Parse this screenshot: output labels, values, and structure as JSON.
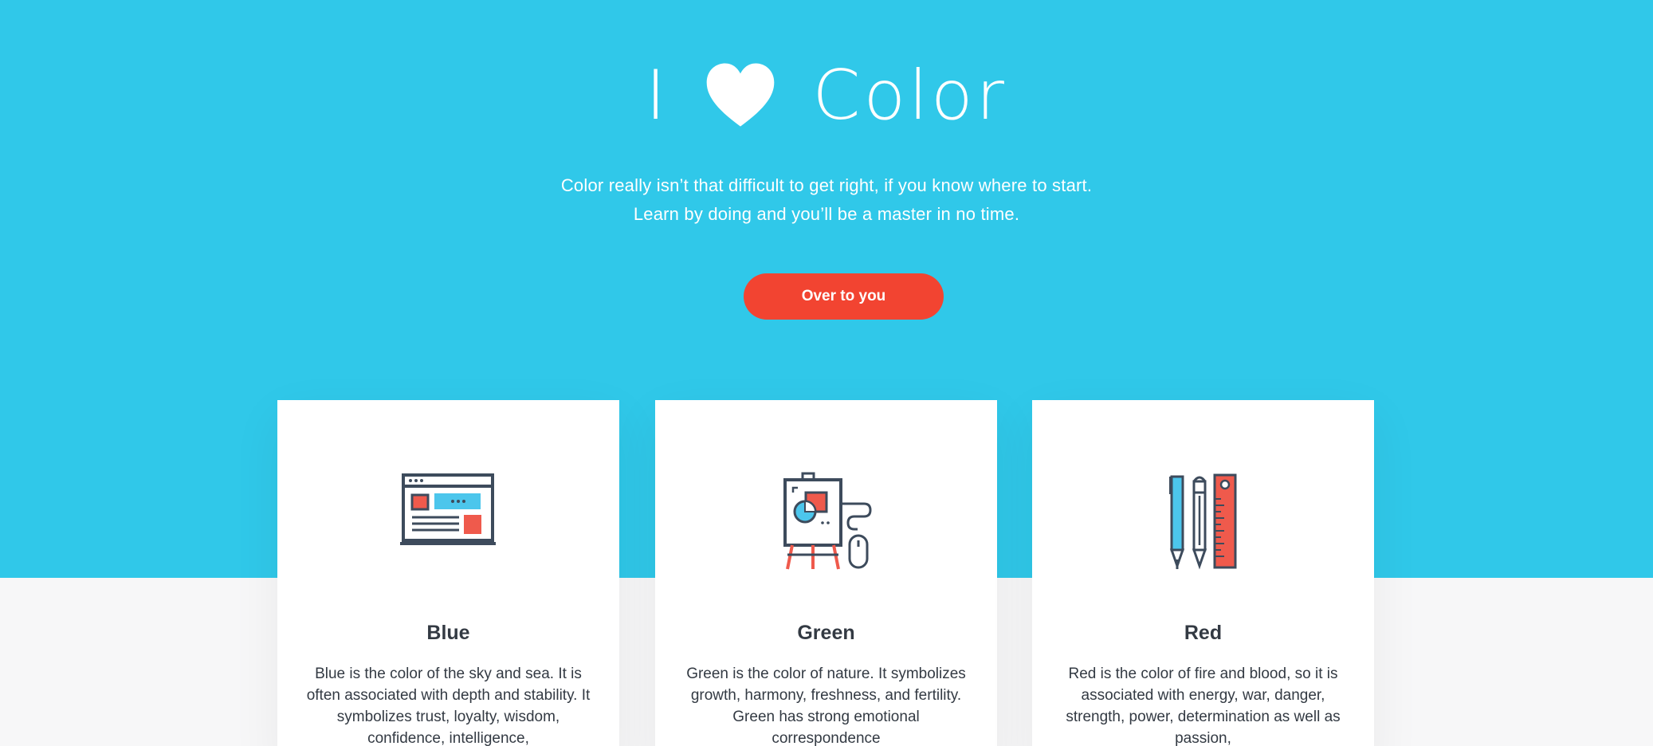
{
  "hero": {
    "title_left": "I",
    "title_right": "Color",
    "heart_icon": "heart-icon",
    "subtitle_line1": "Color really isn’t that difficult to get right, if you know where to start.",
    "subtitle_line2": "Learn by doing and you’ll be a master in no time.",
    "cta_label": "Over to you"
  },
  "colors": {
    "hero_bg": "#30c8e9",
    "cta_bg": "#f24431",
    "card_bg": "#ffffff",
    "page_bg": "#f7f7f8",
    "text_dark": "#333a43"
  },
  "cards": [
    {
      "icon": "browser-window-icon",
      "title": "Blue",
      "text": "Blue is the color of the sky and sea. It is often associated with depth and stability. It symbolizes trust, loyalty, wisdom, confidence, intelligence,"
    },
    {
      "icon": "easel-canvas-icon",
      "title": "Green",
      "text": "Green is the color of nature. It symbolizes growth, harmony, freshness, and fertility. Green has strong emotional correspondence"
    },
    {
      "icon": "pens-ruler-icon",
      "title": "Red",
      "text": "Red is the color of fire and blood, so it is associated with energy, war, danger, strength, power, determination as well as passion,"
    }
  ]
}
